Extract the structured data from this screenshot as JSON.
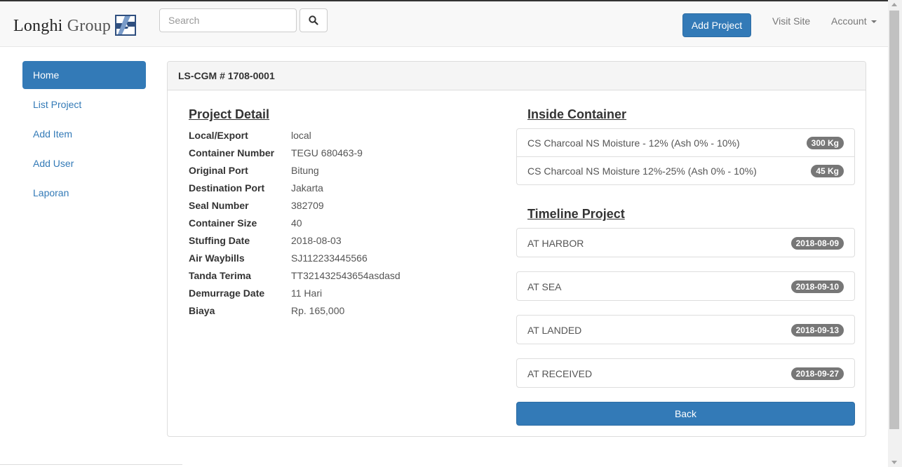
{
  "header": {
    "brand_name_1": "Longhi",
    "brand_name_2": "Group",
    "search_placeholder": "Search",
    "search_icon": "search-icon",
    "add_project_label": "Add Project",
    "visit_site_label": "Visit Site",
    "account_label": "Account"
  },
  "sidebar": {
    "items": [
      {
        "label": "Home",
        "active": true
      },
      {
        "label": "List Project",
        "active": false
      },
      {
        "label": "Add Item",
        "active": false
      },
      {
        "label": "Add User",
        "active": false
      },
      {
        "label": "Laporan",
        "active": false
      }
    ]
  },
  "panel": {
    "heading": "LS-CGM # 1708-0001"
  },
  "project_detail": {
    "title": "Project Detail",
    "rows": [
      {
        "label": "Local/Export",
        "value": "local"
      },
      {
        "label": "Container Number",
        "value": "TEGU 680463-9"
      },
      {
        "label": "Original Port",
        "value": "Bitung"
      },
      {
        "label": "Destination Port",
        "value": "Jakarta"
      },
      {
        "label": "Seal Number",
        "value": "382709"
      },
      {
        "label": "Container Size",
        "value": "40"
      },
      {
        "label": "Stuffing Date",
        "value": "2018-08-03"
      },
      {
        "label": "Air Waybills",
        "value": "SJ112233445566"
      },
      {
        "label": "Tanda Terima",
        "value": "TT321432543654asdasd"
      },
      {
        "label": "Demurrage Date",
        "value": "11 Hari"
      },
      {
        "label": "Biaya",
        "value": "Rp. 165,000"
      }
    ]
  },
  "inside_container": {
    "title": "Inside Container",
    "items": [
      {
        "name": "CS Charcoal NS Moisture - 12% (Ash 0% - 10%)",
        "badge": "300 Kg"
      },
      {
        "name": "CS Charcoal NS Moisture 12%-25% (Ash 0% - 10%)",
        "badge": "45 Kg"
      }
    ]
  },
  "timeline": {
    "title": "Timeline Project",
    "items": [
      {
        "status": "AT HARBOR",
        "date": "2018-08-09"
      },
      {
        "status": "AT SEA",
        "date": "2018-09-10"
      },
      {
        "status": "AT LANDED",
        "date": "2018-09-13"
      },
      {
        "status": "AT RECEIVED",
        "date": "2018-09-27"
      }
    ]
  },
  "actions": {
    "back_label": "Back"
  },
  "colors": {
    "primary": "#337ab7",
    "badge": "#777777"
  }
}
